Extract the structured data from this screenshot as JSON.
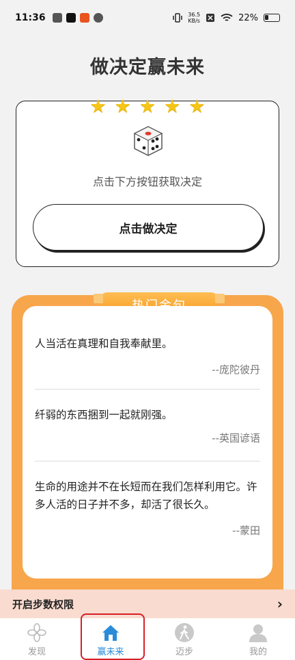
{
  "status_bar": {
    "time": "11:36",
    "net_speed_value": "36.5",
    "net_speed_unit": "KB/s",
    "battery": "22%"
  },
  "page": {
    "title": "做决定赢未来"
  },
  "decision_card": {
    "star_count": 5,
    "hint": "点击下方按钮获取决定",
    "button_label": "点击做决定"
  },
  "quotes": {
    "banner": "热门金句",
    "items": [
      {
        "text": "人当活在真理和自我奉献里。",
        "author": "--庞陀彼丹"
      },
      {
        "text": "纤弱的东西捆到一起就刚强。",
        "author": "--英国谚语"
      },
      {
        "text": "生命的用途并不在长短而在我们怎样利用它。许多人活的日子并不多，却活了很长久。",
        "author": "--蒙田"
      }
    ]
  },
  "permission_bar": {
    "label": "开启步数权限"
  },
  "bottom_nav": {
    "items": [
      {
        "label": "发现",
        "icon": "flower-icon",
        "active": false
      },
      {
        "label": "赢未来",
        "icon": "home-icon",
        "active": true
      },
      {
        "label": "迈步",
        "icon": "walking-icon",
        "active": false
      },
      {
        "label": "我的",
        "icon": "user-icon",
        "active": false
      }
    ]
  },
  "colors": {
    "accent": "#2a8bd8",
    "quotes_frame": "#f7a64c",
    "star": "#f5c518",
    "permission_bg": "#f9dbd0",
    "highlight": "#d61f26"
  }
}
